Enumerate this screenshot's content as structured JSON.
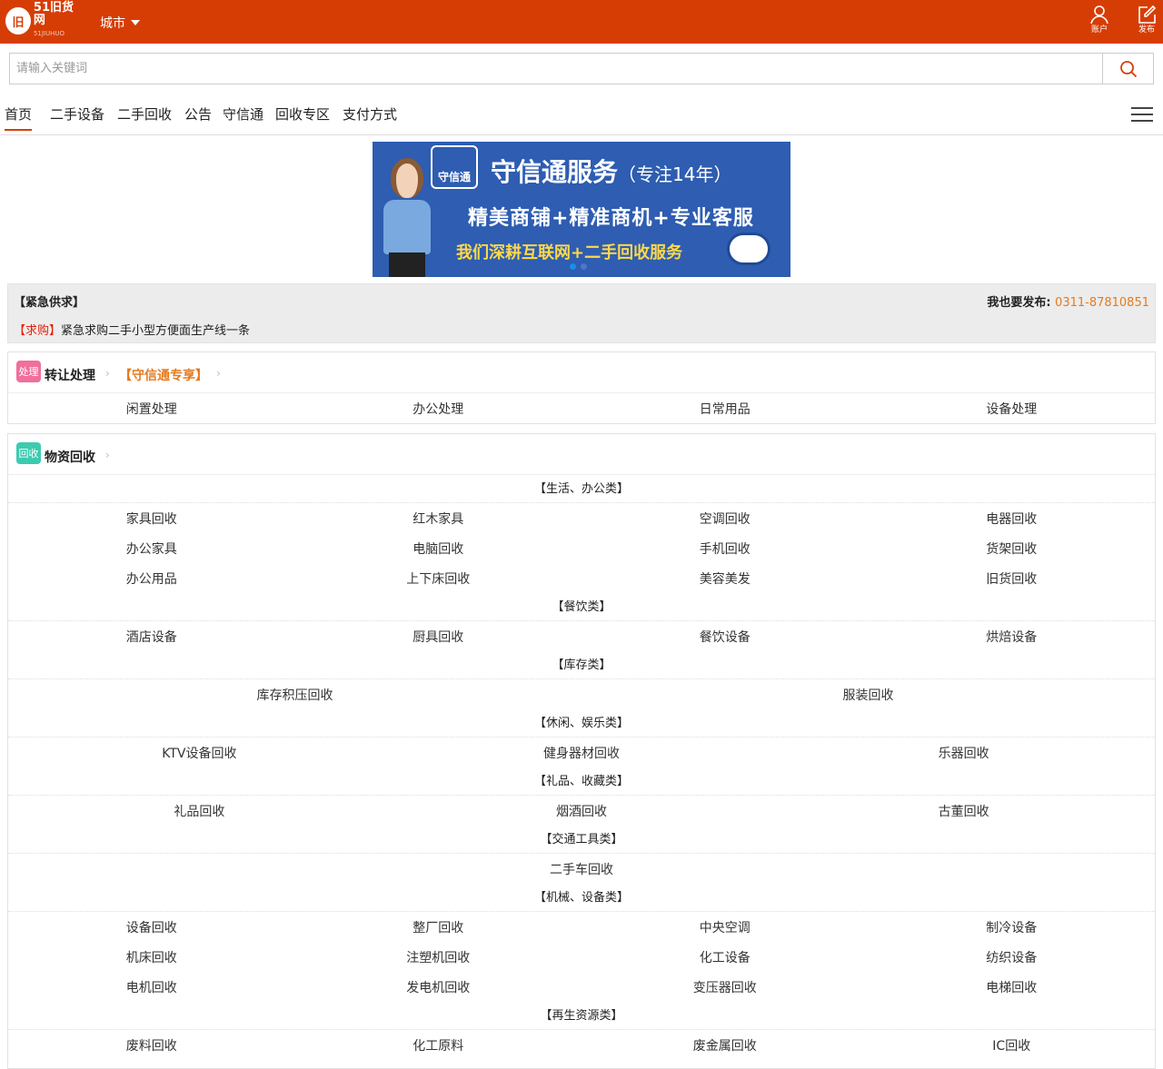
{
  "header": {
    "logo_mark": "旧",
    "logo_text": "51旧货网",
    "logo_sub": "51JIUHUO",
    "city_label": "城市",
    "account_label": "账户",
    "post_label": "发布"
  },
  "search": {
    "placeholder": "请输入关键词"
  },
  "nav": {
    "items": [
      "首页",
      "二手设备",
      "二手回收",
      "公告",
      "守信通",
      "回收专区",
      "支付方式"
    ]
  },
  "banner": {
    "logo_text": "守信通",
    "title": "守信通服务",
    "title_note": "（专注14年）",
    "line2": "精美商铺+精准商机+专业客服",
    "line3": "我们深耕互联网+二手回收服务"
  },
  "urgent": {
    "title": "【紧急供求】",
    "publish_label": "我也要发布:",
    "phone": "0311-87810851",
    "tag": "【求购】",
    "text": "紧急求购二手小型方便面生产线一条"
  },
  "transfer": {
    "badge": "处理",
    "title": "转让处理",
    "sub": "【守信通专享】",
    "items": [
      "闲置处理",
      "办公处理",
      "日常用品",
      "设备处理"
    ]
  },
  "recycle": {
    "badge": "回收",
    "title": "物资回收",
    "categories": [
      {
        "label": "【生活、办公类】",
        "rows": [
          [
            "家具回收",
            "红木家具",
            "空调回收",
            "电器回收"
          ],
          [
            "办公家具",
            "电脑回收",
            "手机回收",
            "货架回收"
          ],
          [
            "办公用品",
            "上下床回收",
            "美容美发",
            "旧货回收"
          ]
        ]
      },
      {
        "label": "【餐饮类】",
        "rows": [
          [
            "酒店设备",
            "厨具回收",
            "餐饮设备",
            "烘焙设备"
          ]
        ]
      },
      {
        "label": "【库存类】",
        "rows": [
          [
            "库存积压回收",
            "服装回收"
          ]
        ]
      },
      {
        "label": "【休闲、娱乐类】",
        "rows": [
          [
            "KTV设备回收",
            "健身器材回收",
            "乐器回收"
          ]
        ]
      },
      {
        "label": "【礼品、收藏类】",
        "rows": [
          [
            "礼品回收",
            "烟酒回收",
            "古董回收"
          ]
        ]
      },
      {
        "label": "【交通工具类】",
        "rows": [
          [
            "二手车回收"
          ]
        ]
      },
      {
        "label": "【机械、设备类】",
        "rows": [
          [
            "设备回收",
            "整厂回收",
            "中央空调",
            "制冷设备"
          ],
          [
            "机床回收",
            "注塑机回收",
            "化工设备",
            "纺织设备"
          ],
          [
            "电机回收",
            "发电机回收",
            "变压器回收",
            "电梯回收"
          ]
        ]
      },
      {
        "label": "【再生资源类】",
        "rows": [
          [
            "废料回收",
            "化工原料",
            "废金属回收",
            "IC回收"
          ]
        ]
      }
    ]
  },
  "colors": {
    "brand": "#d63d04",
    "accent_orange": "#e57a1e",
    "tag_red": "#e0220f",
    "badge_pink": "#f06f9c",
    "badge_teal": "#3ccbb0"
  },
  "icons": [
    "user-icon",
    "edit-icon",
    "search-icon",
    "menu-icon",
    "chevron-right-icon",
    "caret-down-icon"
  ]
}
